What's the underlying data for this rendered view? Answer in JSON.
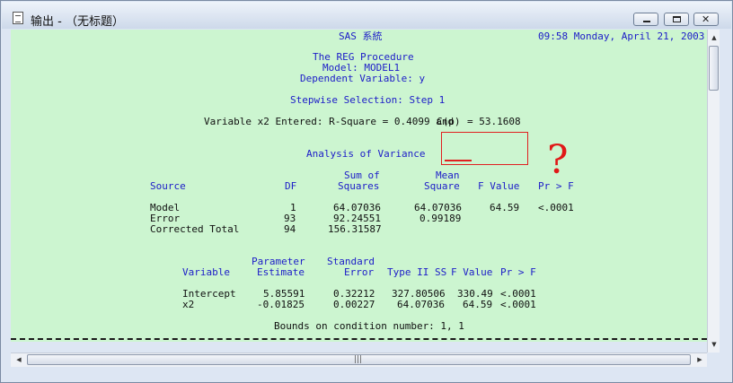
{
  "window": {
    "title": "输出 - （无标题）",
    "buttons": {
      "minimize": "minimize-icon",
      "maximize": "maximize-icon",
      "close": "close-icon",
      "close_glyph": "✕"
    }
  },
  "output": {
    "header": {
      "system": "SAS 系統",
      "datetime": "09:58 Monday, April 21, 2003",
      "procedure": "The REG Procedure",
      "model": "Model: MODEL1",
      "dependent": "Dependent Variable: y"
    },
    "step": {
      "title": "Stepwise Selection: Step 1",
      "entered_prefix": "Variable x2 Entered: R-Square = 0.4099 and",
      "cp_label": "C(p)",
      "cp_value": "= 53.1608"
    },
    "anova": {
      "title": "Analysis of Variance",
      "headers": {
        "source": "Source",
        "df": "DF",
        "ss_line1": "Sum of",
        "ss_line2": "Squares",
        "ms_line1": "Mean",
        "ms_line2": "Square",
        "fvalue": "F Value",
        "pr": "Pr > F"
      },
      "rows": [
        {
          "source": "Model",
          "df": "1",
          "ss": "64.07036",
          "ms": "64.07036",
          "f": "64.59",
          "p": "<.0001"
        },
        {
          "source": "Error",
          "df": "93",
          "ss": "92.24551",
          "ms": "0.99189",
          "f": "",
          "p": ""
        },
        {
          "source": "Corrected Total",
          "df": "94",
          "ss": "156.31587",
          "ms": "",
          "f": "",
          "p": ""
        }
      ]
    },
    "params": {
      "headers": {
        "variable": "Variable",
        "est_line1": "Parameter",
        "est_line2": "Estimate",
        "se_line1": "Standard",
        "se_line2": "Error",
        "t2ss": "Type II SS",
        "fvalue": "F Value",
        "pr": "Pr > F"
      },
      "rows": [
        {
          "var": "Intercept",
          "est": "5.85591",
          "se": "0.32212",
          "ss": "327.80506",
          "f": "330.49",
          "p": "<.0001"
        },
        {
          "var": "x2",
          "est": "-0.01825",
          "se": "0.00227",
          "ss": "64.07036",
          "f": "64.59",
          "p": "<.0001"
        }
      ]
    },
    "bounds": "Bounds on condition number: 1, 1"
  },
  "annotation": {
    "question_mark": "?",
    "color": "#e01818"
  },
  "scrollbars": {
    "up_arrow": "▲",
    "down_arrow": "▼",
    "left_arrow": "◀",
    "right_arrow": "▶",
    "grip": "|||"
  },
  "colors": {
    "output_bg": "#ccf5d0",
    "blue_text": "#1c1cc8",
    "window_frame": "#dde6f3"
  }
}
